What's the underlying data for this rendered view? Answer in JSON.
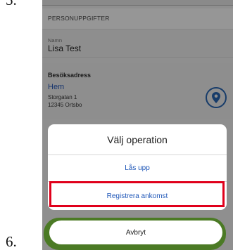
{
  "steps": {
    "first": "5.",
    "second": "6."
  },
  "section": {
    "header": "PERSONUPPGIFTER"
  },
  "person": {
    "name_label": "Namn",
    "name_value": "Lisa Test"
  },
  "address": {
    "title": "Besöksadress",
    "name": "Hem",
    "street": "Storgatan 1",
    "postal": "12345 Ortsbo",
    "icon": "location-pin-icon"
  },
  "action_sheet": {
    "title": "Välj operation",
    "options": [
      {
        "label": "Lås upp"
      },
      {
        "label": "Registrera ankomst"
      }
    ],
    "cancel_label": "Avbryt"
  },
  "colors": {
    "highlight": "#e0001b",
    "link_blue": "#1f57b8",
    "pin_navy": "#173c6a",
    "green_accent": "#4b7a25"
  }
}
